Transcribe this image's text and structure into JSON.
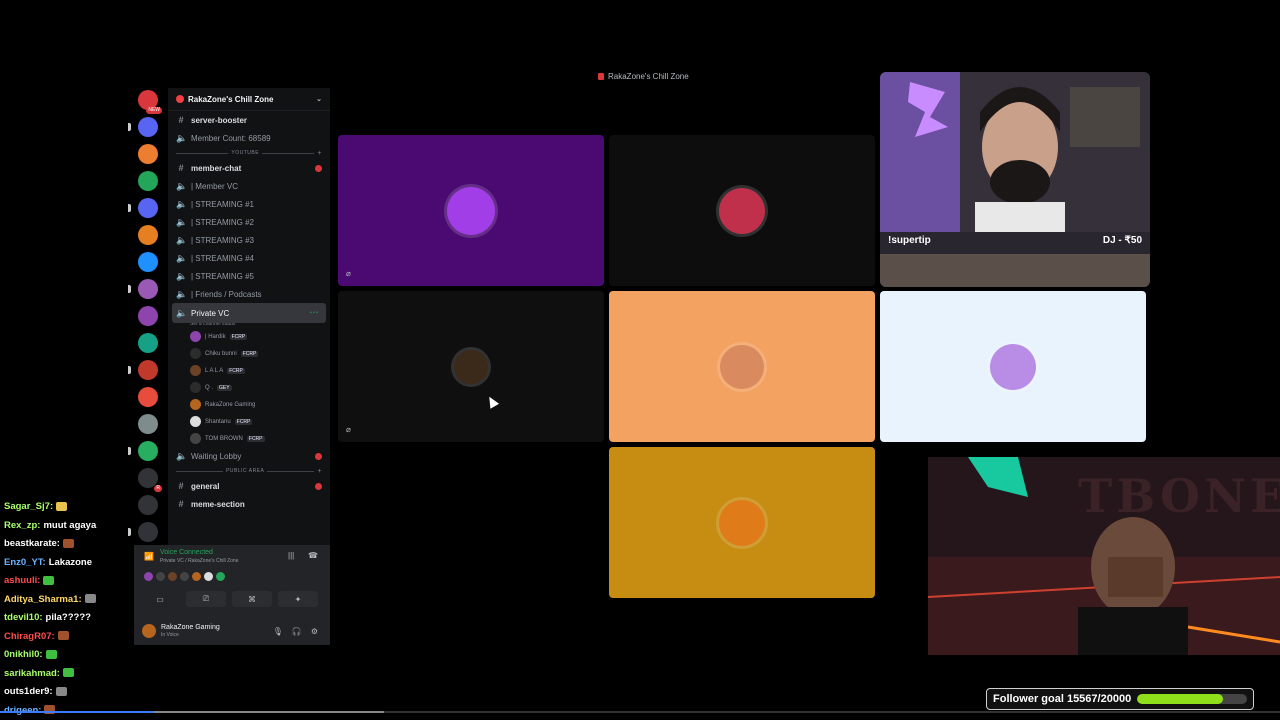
{
  "window": {
    "title": "RakaZone's Chill Zone"
  },
  "server": {
    "name": "RakaZone's Chill Zone",
    "rail_items": [
      {
        "badge": "NEW",
        "color": "#da373c"
      },
      {
        "badge": "",
        "color": "#5865f2"
      },
      {
        "badge": "",
        "color": "#ed7d31"
      },
      {
        "badge": "",
        "color": "#23a55a"
      },
      {
        "badge": "",
        "color": "#5865f2"
      },
      {
        "badge": "",
        "color": "#e67e22"
      },
      {
        "badge": "",
        "color": "#1e90ff"
      },
      {
        "badge": "",
        "color": "#9b59b6"
      },
      {
        "badge": "",
        "color": "#8e44ad"
      },
      {
        "badge": "",
        "color": "#16a085"
      },
      {
        "badge": "",
        "color": "#c0392b"
      },
      {
        "badge": "",
        "color": "#e74c3c"
      },
      {
        "badge": "",
        "color": "#7f8c8d"
      },
      {
        "badge": "",
        "color": "#27ae60"
      },
      {
        "badge": "R",
        "color": "#313338"
      },
      {
        "badge": "",
        "color": "#313338"
      },
      {
        "badge": "",
        "color": "#313338"
      }
    ]
  },
  "sidebar": {
    "top_channels": [
      {
        "icon": "#",
        "label": "server-booster"
      },
      {
        "icon": "🔈",
        "label": "Member Count: 68589"
      }
    ],
    "category_youtube": "YOUTUBE",
    "channels": [
      {
        "icon": "#",
        "label": "member-chat",
        "bright": true,
        "unread": true
      },
      {
        "icon": "🔈",
        "label": "| Member VC"
      },
      {
        "icon": "🔈",
        "label": "| STREAMING #1"
      },
      {
        "icon": "🔈",
        "label": "| STREAMING #2"
      },
      {
        "icon": "🔈",
        "label": "| STREAMING #3"
      },
      {
        "icon": "🔈",
        "label": "| STREAMING #4"
      },
      {
        "icon": "🔈",
        "label": "| STREAMING #5"
      },
      {
        "icon": "🔈",
        "label": "| Friends / Podcasts"
      }
    ],
    "private_vc": {
      "label": "Private VC",
      "status": "Set a channel status"
    },
    "members": [
      {
        "name": "| Hardik",
        "tag": "FCRP",
        "color": "#8e44ad"
      },
      {
        "name": "Chiku bunni",
        "tag": "FCRP",
        "color": "#2c2c2c"
      },
      {
        "name": "L A L A",
        "tag": "FCRP",
        "color": "#6b4226"
      },
      {
        "name": "Q .",
        "tag": "GEY",
        "color": "#2c2c2c"
      },
      {
        "name": "RakaZone Gaming",
        "tag": "",
        "color": "#b5651d"
      },
      {
        "name": "Shantanu",
        "tag": "FCRP",
        "color": "#dddddd"
      },
      {
        "name": "TOM BROWN",
        "tag": "FCRP",
        "color": "#444444"
      }
    ],
    "waiting_lobby": "Waiting Lobby",
    "category_public": "PUBLIC AREA",
    "general": "general",
    "meme": "meme-section"
  },
  "voice_panel": {
    "status": "Voice Connected",
    "channel": "Private VC / RakaZone's Chill Zone",
    "user_name": "RakaZone Gaming",
    "user_status": "In Voice"
  },
  "tiles": [
    {
      "bg": "#4a0a72",
      "avatar": "#a23ee8",
      "muted": true
    },
    {
      "bg": "#0d0d0d",
      "avatar": "#c0304a",
      "muted": false
    },
    {
      "bg": "#0f0f0f",
      "avatar": "#3b2a1a",
      "muted": true
    },
    {
      "bg": "#f4a261",
      "avatar": "#d98b5f",
      "muted": false
    },
    {
      "bg": "#e9f3fd",
      "avatar": "#b98ce6",
      "muted": false
    },
    {
      "bg": "#c78d12",
      "avatar": "#e07b1a",
      "muted": false
    }
  ],
  "webcam_top": {
    "command": "!supertip",
    "tip": "DJ - ₹50"
  },
  "webcam_bottom": {
    "sign": "TBONE"
  },
  "chat": [
    {
      "user": "Sagar_Sj7:",
      "color": "#a8ff6b",
      "text": "",
      "emote": "#e8c34d"
    },
    {
      "user": "Rex_zp:",
      "color": "#a8ff6b",
      "text": "muut agaya",
      "emote": ""
    },
    {
      "user": "beastkarate:",
      "color": "#ffffff",
      "text": "",
      "emote": "#a0522d"
    },
    {
      "user": "Enz0_YT:",
      "color": "#6cb4ff",
      "text": "Lakazone",
      "emote": ""
    },
    {
      "user": "ashuuli:",
      "color": "#ff4d4d",
      "text": "",
      "emote": "#3fbf3f"
    },
    {
      "user": "Aditya_Sharma1:",
      "color": "#ffd966",
      "text": "",
      "emote": "#888888"
    },
    {
      "user": "tdevil10:",
      "color": "#a8ff6b",
      "text": "pila?????",
      "emote": ""
    },
    {
      "user": "ChiragR07:",
      "color": "#ff4d4d",
      "text": "",
      "emote": "#a0522d"
    },
    {
      "user": "0nikhil0:",
      "color": "#a8ff6b",
      "text": "",
      "emote": "#3fbf3f"
    },
    {
      "user": "sarikahmad:",
      "color": "#a8ff6b",
      "text": "",
      "emote": "#3fbf3f"
    },
    {
      "user": "outs1der9:",
      "color": "#ffffff",
      "text": "",
      "emote": "#888888"
    },
    {
      "user": "drigeen:",
      "color": "#6cb4ff",
      "text": "",
      "emote": "#a0522d"
    }
  ],
  "follower_goal": {
    "label": "Follower goal 15567/20000",
    "current": 15567,
    "target": 20000
  },
  "playback_progress": {
    "played": 0.12,
    "buffered": 0.3
  }
}
